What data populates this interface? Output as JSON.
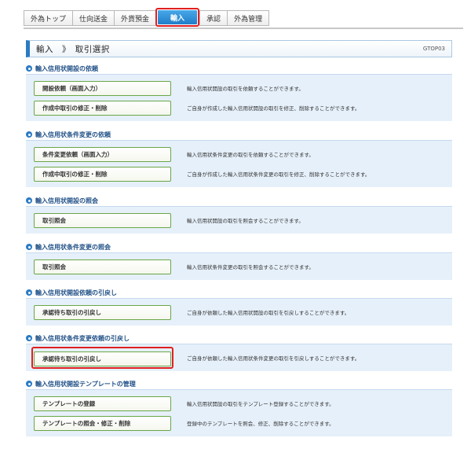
{
  "tabs": [
    {
      "label": "外為トップ",
      "active": false
    },
    {
      "label": "仕向送金",
      "active": false
    },
    {
      "label": "外貨預金",
      "active": false
    },
    {
      "label": "輸入",
      "active": true
    },
    {
      "label": "承認",
      "active": false
    },
    {
      "label": "外為管理",
      "active": false
    }
  ],
  "header": {
    "title": "輸入　》　取引選択",
    "code": "GTOP03"
  },
  "sections": [
    {
      "title": "輸入信用状開設の依頼",
      "rows": [
        {
          "button": "開設依頼（画面入力）",
          "desc": "輸入信用状開設の取引を依頼することができます。"
        },
        {
          "button": "作成中取引の修正・削除",
          "desc": "ご自身が作成した輸入信用状開設の取引を修正、削除することができます。"
        }
      ]
    },
    {
      "title": "輸入信用状条件変更の依頼",
      "rows": [
        {
          "button": "条件変更依頼（画面入力）",
          "desc": "輸入信用状条件変更の取引を依頼することができます。"
        },
        {
          "button": "作成中取引の修正・削除",
          "desc": "ご自身が作成した輸入信用状条件変更の取引を修正、削除することができます。"
        }
      ]
    },
    {
      "title": "輸入信用状開設の照会",
      "rows": [
        {
          "button": "取引照会",
          "desc": "輸入信用状開設の取引を照会することができます。"
        }
      ]
    },
    {
      "title": "輸入信用状条件変更の照会",
      "rows": [
        {
          "button": "取引照会",
          "desc": "輸入信用状条件変更の取引を照会することができます。"
        }
      ]
    },
    {
      "title": "輸入信用状開設依頼の引戻し",
      "rows": [
        {
          "button": "承認待ち取引の引戻し",
          "desc": "ご自身が依頼した輸入信用状開設の取引を引戻しすることができます。"
        }
      ]
    },
    {
      "title": "輸入信用状条件変更依頼の引戻し",
      "rows": [
        {
          "button": "承認待ち取引の引戻し",
          "desc": "ご自身が依頼した輸入信用状条件変更の取引を引戻しすることができます。"
        }
      ]
    },
    {
      "title": "輸入信用状開設テンプレートの管理",
      "rows": [
        {
          "button": "テンプレートの登録",
          "desc": "輸入信用状開設の取引をテンプレート登録することができます。"
        },
        {
          "button": "テンプレートの照会・修正・削除",
          "desc": "登録中のテンプレートを照会、修正、削除することができます。"
        }
      ]
    }
  ]
}
